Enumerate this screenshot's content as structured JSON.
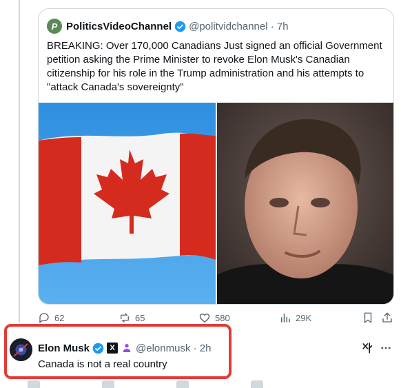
{
  "quoted_tweet": {
    "avatar_letter": "P",
    "display_name": "PoliticsVideoChannel",
    "handle_time": "@politvidchannel · 7h",
    "text": "BREAKING: Over 170,000 Canadians Just signed an official Government petition asking the Prime Minister to revoke Elon Musk's Canadian citizenship for his role in the Trump administration and his attempts to \"attack Canada's sovereignty\"",
    "media": [
      "canada-flag-image",
      "person-portrait-image"
    ]
  },
  "actions": {
    "replies": "62",
    "reposts": "65",
    "likes": "580",
    "views": "29K"
  },
  "reply_tweet": {
    "display_name": "Elon Musk",
    "x_badge": "X",
    "handle_time": "@elonmusk · 2h",
    "text": "Canada is not a real country"
  },
  "colors": {
    "verified_blue": "#1d9bf0",
    "highlight_red": "#e23b36",
    "secondary_text": "#536471"
  }
}
